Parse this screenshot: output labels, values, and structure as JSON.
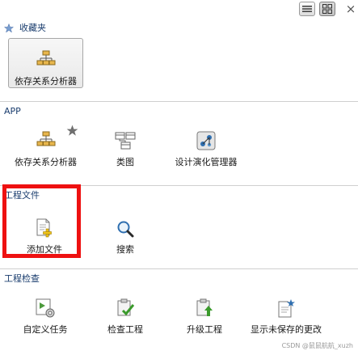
{
  "sections": {
    "favorites": {
      "title": "收藏夹",
      "items": [
        {
          "label": "依存关系分析器",
          "icon": "dependency-tree-icon"
        }
      ]
    },
    "app": {
      "title": "APP",
      "items": [
        {
          "label": "依存关系分析器",
          "icon": "dependency-tree-icon"
        },
        {
          "label": "类图",
          "icon": "class-diagram-icon"
        },
        {
          "label": "设计演化管理器",
          "icon": "design-evolution-icon"
        }
      ]
    },
    "project_files": {
      "title": "工程文件",
      "items": [
        {
          "label": "添加文件",
          "icon": "add-file-icon"
        },
        {
          "label": "搜索",
          "icon": "search-icon"
        }
      ]
    },
    "project_check": {
      "title": "工程检查",
      "items": [
        {
          "label": "自定义任务",
          "icon": "custom-task-icon"
        },
        {
          "label": "检查工程",
          "icon": "check-project-icon"
        },
        {
          "label": "升级工程",
          "icon": "upgrade-project-icon"
        },
        {
          "label": "显示未保存的更改",
          "icon": "unsaved-changes-icon"
        }
      ]
    }
  },
  "toolbar": {
    "close_glyph": "×"
  },
  "watermark": "CSDN @鼠鼠航航_xuzh",
  "colors": {
    "highlight": "#ee1111",
    "section_title": "#1a3d6e"
  }
}
